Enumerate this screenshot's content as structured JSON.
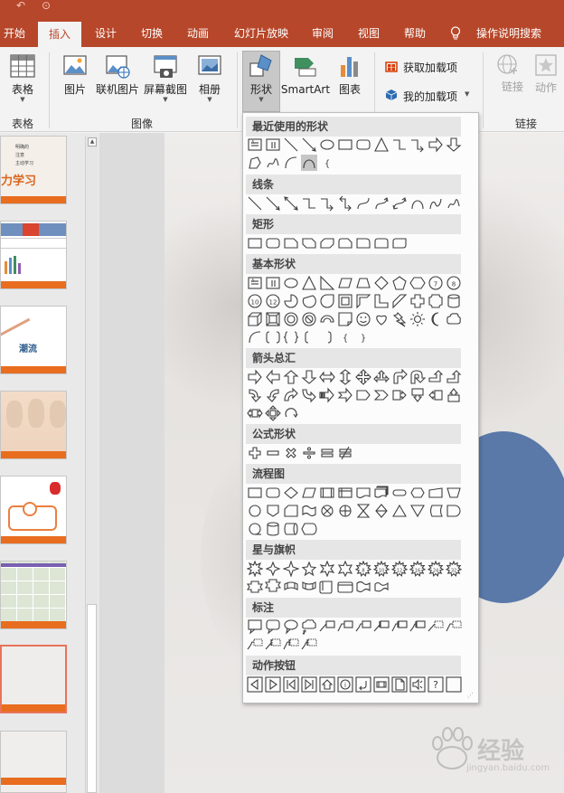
{
  "ribbon_tabs": [
    "开始",
    "插入",
    "设计",
    "切换",
    "动画",
    "幻灯片放映",
    "审阅",
    "视图",
    "帮助",
    "操作说明搜索"
  ],
  "ribbon": {
    "table": {
      "label": "表格",
      "group": "表格"
    },
    "images": {
      "picture": "图片",
      "online_picture": "联机图片",
      "screenshot": "屏幕截图",
      "album": "相册",
      "group": "图像"
    },
    "illustrations": {
      "shapes": "形状",
      "smartart": "SmartArt",
      "chart": "图表"
    },
    "addins": {
      "get": "获取加载项",
      "my": "我的加载项"
    },
    "links": {
      "link": "链接",
      "action": "动作",
      "group": "链接"
    },
    "colors": {
      "accent": "#b7472a",
      "store_icon": "#d83b01",
      "myaddins_icon": "#2b6cb0"
    }
  },
  "shapes_menu": {
    "sections": [
      "最近使用的形状",
      "线条",
      "矩形",
      "基本形状",
      "箭头总汇",
      "公式形状",
      "流程图",
      "星与旗帜",
      "标注",
      "动作按钮"
    ],
    "recent_brace_glyph": "{",
    "basic_glyphs": [
      "8",
      "10",
      "12",
      "{",
      "}"
    ],
    "stars_glyphs": [
      "8",
      "10",
      "12",
      "16",
      "24",
      "32"
    ],
    "action_glyphs": [
      "?"
    ]
  },
  "thumbnails": {
    "slide1_lines": [
      "明确的",
      "注意",
      "主动学习"
    ],
    "slide1_big": "力学习",
    "slide3_big": "潮流"
  },
  "watermark": {
    "text": "经验",
    "sub": "jingyan.baidu.com"
  }
}
